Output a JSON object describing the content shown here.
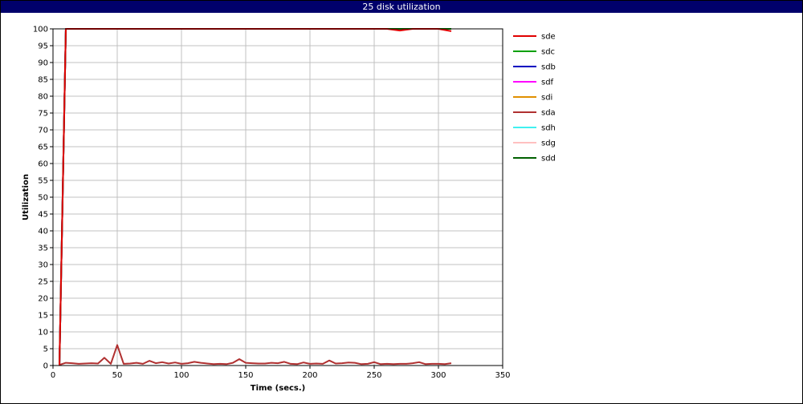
{
  "window": {
    "title": "25 disk utilization"
  },
  "colors": {
    "titlebar_bg": "#00006b",
    "grid": "#c0c0c0"
  },
  "chart_data": {
    "type": "line",
    "title": "25 disk utilization",
    "xlabel": "Time (secs.)",
    "ylabel": "Utilization",
    "xlim": [
      0,
      350
    ],
    "ylim": [
      0,
      100
    ],
    "xticks": [
      0,
      50,
      100,
      150,
      200,
      250,
      300,
      350
    ],
    "yticks": [
      0,
      5,
      10,
      15,
      20,
      25,
      30,
      35,
      40,
      45,
      50,
      55,
      60,
      65,
      70,
      75,
      80,
      85,
      90,
      95,
      100
    ],
    "grid": true,
    "legend_position": "right",
    "series": [
      {
        "name": "sde",
        "color": "#e00000",
        "x": [
          5,
          10,
          15,
          20,
          40,
          60,
          80,
          100,
          120,
          140,
          160,
          180,
          200,
          220,
          240,
          260,
          270,
          280,
          300,
          310
        ],
        "y": [
          0,
          100,
          100,
          100,
          100,
          100,
          100,
          100,
          100,
          100,
          100,
          100,
          100,
          100,
          100,
          100,
          99.5,
          100,
          100,
          99.3
        ]
      },
      {
        "name": "sdc",
        "color": "#00a000",
        "x": [
          5,
          10,
          15,
          100,
          200,
          300,
          310
        ],
        "y": [
          0,
          100,
          100,
          100,
          100,
          100,
          100
        ]
      },
      {
        "name": "sdb",
        "color": "#0000c0",
        "x": [
          5,
          10,
          15,
          100,
          200,
          300,
          310
        ],
        "y": [
          0,
          100,
          100,
          100,
          100,
          100,
          100
        ]
      },
      {
        "name": "sdf",
        "color": "#ff00ff",
        "x": [
          5,
          10,
          15,
          100,
          200,
          300,
          310
        ],
        "y": [
          0,
          100,
          100,
          100,
          100,
          100,
          100
        ]
      },
      {
        "name": "sdi",
        "color": "#e09000",
        "x": [
          5,
          10,
          15,
          100,
          200,
          300,
          310
        ],
        "y": [
          0,
          100,
          100,
          100,
          100,
          100,
          100
        ]
      },
      {
        "name": "sda",
        "color": "#b03030",
        "x": [
          5,
          10,
          15,
          20,
          25,
          30,
          35,
          40,
          45,
          50,
          55,
          60,
          65,
          70,
          75,
          80,
          85,
          90,
          95,
          100,
          105,
          110,
          115,
          120,
          125,
          130,
          135,
          140,
          145,
          150,
          155,
          160,
          165,
          170,
          175,
          180,
          185,
          190,
          195,
          200,
          205,
          210,
          215,
          220,
          225,
          230,
          235,
          240,
          245,
          250,
          255,
          260,
          265,
          270,
          275,
          280,
          285,
          290,
          295,
          300,
          305,
          310
        ],
        "y": [
          0.2,
          0.8,
          0.7,
          0.5,
          0.6,
          0.7,
          0.6,
          2.3,
          0.5,
          6.1,
          0.5,
          0.6,
          0.8,
          0.5,
          1.4,
          0.7,
          1.0,
          0.6,
          0.9,
          0.5,
          0.7,
          1.1,
          0.8,
          0.6,
          0.4,
          0.5,
          0.4,
          0.8,
          1.9,
          0.8,
          0.7,
          0.6,
          0.6,
          0.8,
          0.7,
          1.1,
          0.5,
          0.4,
          0.9,
          0.5,
          0.6,
          0.5,
          1.5,
          0.6,
          0.7,
          0.9,
          0.8,
          0.4,
          0.5,
          1.0,
          0.4,
          0.5,
          0.4,
          0.5,
          0.5,
          0.7,
          1.0,
          0.4,
          0.5,
          0.5,
          0.4,
          0.7
        ]
      },
      {
        "name": "sdh",
        "color": "#40f0f0",
        "x": [
          5,
          10,
          15,
          100,
          200,
          300,
          310
        ],
        "y": [
          0,
          100,
          100,
          100,
          100,
          100,
          100
        ]
      },
      {
        "name": "sdg",
        "color": "#ffc0c0",
        "x": [
          5,
          10,
          15,
          100,
          200,
          300,
          310
        ],
        "y": [
          0,
          100,
          100,
          100,
          100,
          100,
          100
        ]
      },
      {
        "name": "sdd",
        "color": "#006000",
        "x": [
          5,
          10,
          15,
          100,
          200,
          300,
          310
        ],
        "y": [
          0,
          100,
          100,
          100,
          100,
          100,
          100
        ]
      }
    ]
  }
}
